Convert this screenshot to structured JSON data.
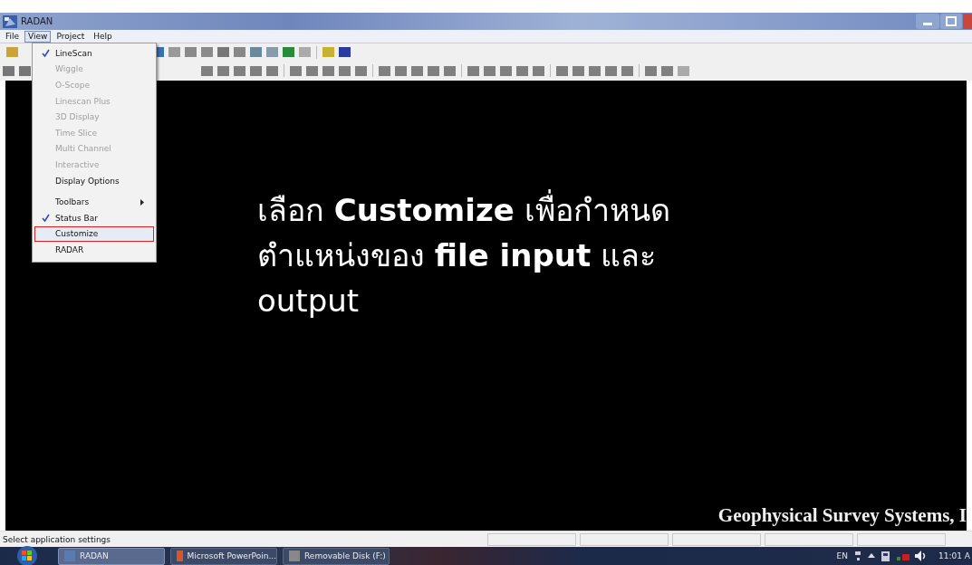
{
  "window": {
    "title": "RADAN"
  },
  "menu_bar": [
    {
      "label": "File",
      "selected": false
    },
    {
      "label": "View",
      "selected": true
    },
    {
      "label": "Project",
      "selected": false
    },
    {
      "label": "Help",
      "selected": false
    }
  ],
  "view_menu": [
    {
      "kind": "item",
      "label": "LineScan",
      "checked": true,
      "disabled": false,
      "highlighted": false
    },
    {
      "kind": "item",
      "label": "Wiggle",
      "checked": false,
      "disabled": true,
      "highlighted": false
    },
    {
      "kind": "item",
      "label": "O-Scope",
      "checked": false,
      "disabled": true,
      "highlighted": false
    },
    {
      "kind": "item",
      "label": "Linescan Plus",
      "checked": false,
      "disabled": true,
      "highlighted": false
    },
    {
      "kind": "item",
      "label": "3D Display",
      "checked": false,
      "disabled": true,
      "highlighted": false
    },
    {
      "kind": "item",
      "label": "Time Slice",
      "checked": false,
      "disabled": true,
      "highlighted": false
    },
    {
      "kind": "item",
      "label": "Multi Channel",
      "checked": false,
      "disabled": true,
      "highlighted": false
    },
    {
      "kind": "item",
      "label": "Interactive",
      "checked": false,
      "disabled": true,
      "highlighted": false
    },
    {
      "kind": "item",
      "label": "Display Options",
      "checked": false,
      "disabled": false,
      "highlighted": false
    },
    {
      "kind": "separator"
    },
    {
      "kind": "submenu",
      "label": "Toolbars",
      "checked": false,
      "disabled": false,
      "highlighted": false
    },
    {
      "kind": "item",
      "label": "Status Bar",
      "checked": true,
      "disabled": false,
      "highlighted": false
    },
    {
      "kind": "item",
      "label": "Customize",
      "checked": false,
      "disabled": false,
      "highlighted": true
    },
    {
      "kind": "item",
      "label": "RADAR",
      "checked": false,
      "disabled": false,
      "highlighted": false
    }
  ],
  "overlay_text": {
    "lines": [
      "เลือก **Customize** เพื่อกำหนด",
      "ตำแหน่งของ **file input** และ",
      "output"
    ]
  },
  "company_caption": "Geophysical Survey Systems, I",
  "status_bar": {
    "message": "Select application settings"
  },
  "taskbar": {
    "buttons": [
      {
        "label": "RADAN",
        "selected": true
      },
      {
        "label": "Microsoft PowerPoin...",
        "selected": false
      },
      {
        "label": "Removable Disk (F:)",
        "selected": false
      }
    ],
    "language": "EN",
    "clock": "11:01 A"
  }
}
